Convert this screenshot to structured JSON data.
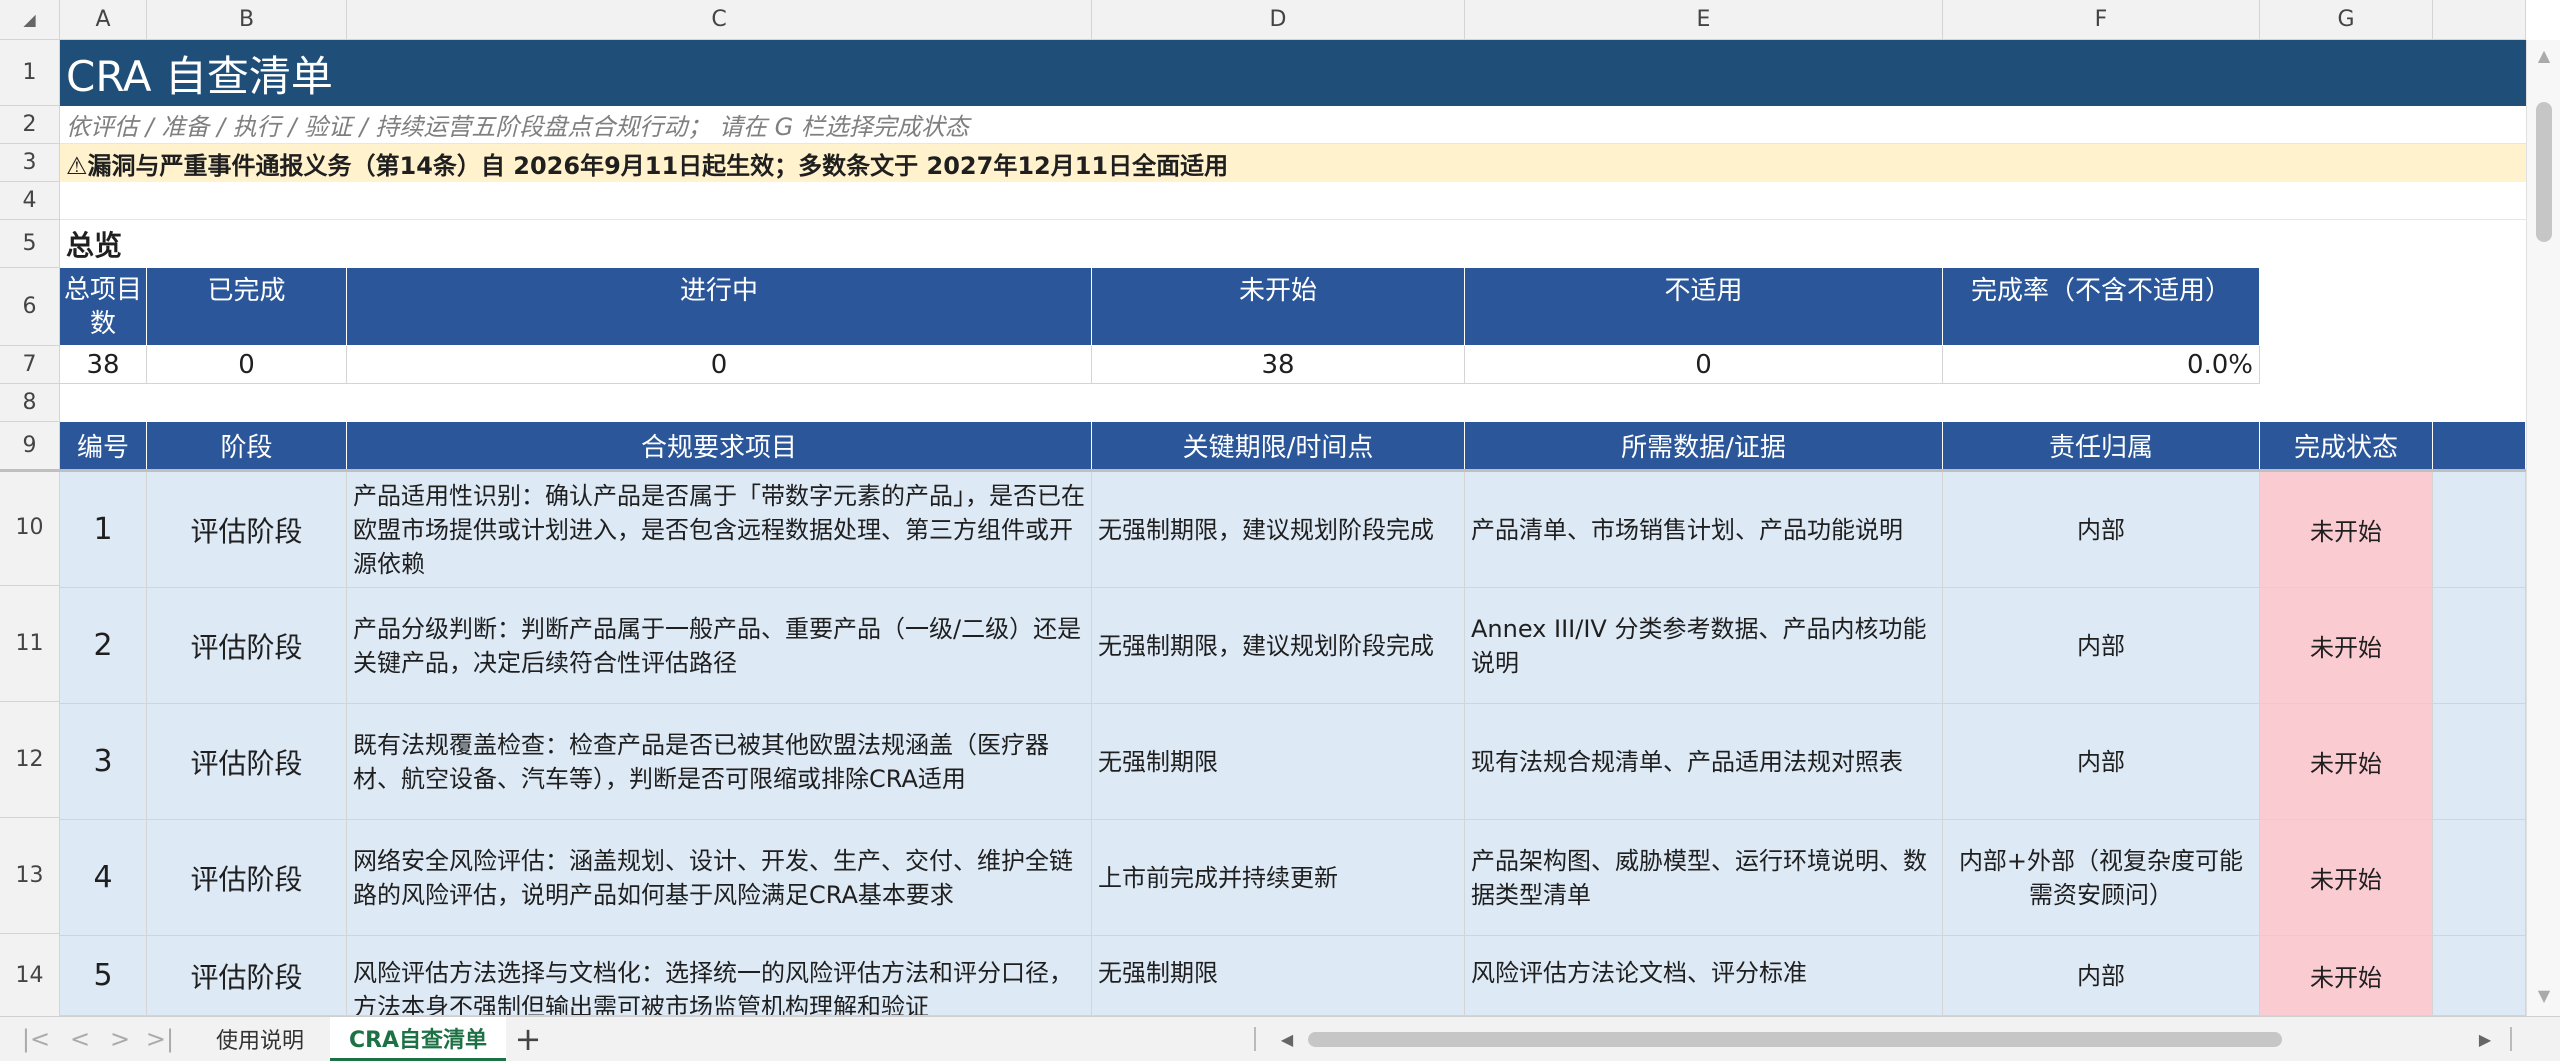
{
  "columns": [
    "A",
    "B",
    "C",
    "D",
    "E",
    "F",
    "G"
  ],
  "row_numbers": [
    "1",
    "2",
    "3",
    "4",
    "5",
    "6",
    "7",
    "8",
    "9",
    "10",
    "11",
    "12",
    "13",
    "14"
  ],
  "title": "CRA 自查清单",
  "subtitle": "依评估 / 准备 / 执行 / 验证 / 持续运营五阶段盘点合规行动； 请在 G 栏选择完成状态",
  "warning": "⚠漏洞与严重事件通报义务（第14条）自 2026年9月11日起生效；多数条文于 2027年12月11日全面适用",
  "overview_label": "总览",
  "summary": {
    "headers": [
      "总项目数",
      "已完成",
      "进行中",
      "未开始",
      "不适用",
      "完成率（不含不适用）"
    ],
    "values": [
      "38",
      "0",
      "0",
      "38",
      "0",
      "0.0%"
    ]
  },
  "table": {
    "headers": [
      "编号",
      "阶段",
      "合规要求项目",
      "关键期限/时间点",
      "所需数据/证据",
      "责任归属",
      "完成状态"
    ],
    "rows": [
      {
        "no": "1",
        "stage": "评估阶段",
        "item": "产品适用性识别：确认产品是否属于「带数字元素的产品」，是否已在欧盟市场提供或计划进入，是否包含远程数据处理、第三方组件或开源依赖",
        "deadline": "无强制期限，建议规划阶段完成",
        "evidence": "产品清单、市场销售计划、产品功能说明",
        "owner": "内部",
        "status": "未开始"
      },
      {
        "no": "2",
        "stage": "评估阶段",
        "item": "产品分级判断：判断产品属于一般产品、重要产品（一级/二级）还是关键产品，决定后续符合性评估路径",
        "deadline": "无强制期限，建议规划阶段完成",
        "evidence": "Annex III/IV 分类参考数据、产品内核功能说明",
        "owner": "内部",
        "status": "未开始"
      },
      {
        "no": "3",
        "stage": "评估阶段",
        "item": "既有法规覆盖检查：检查产品是否已被其他欧盟法规涵盖（医疗器材、航空设备、汽车等），判断是否可限缩或排除CRA适用",
        "deadline": "无强制期限",
        "evidence": "现有法规合规清单、产品适用法规对照表",
        "owner": "内部",
        "status": "未开始"
      },
      {
        "no": "4",
        "stage": "评估阶段",
        "item": "网络安全风险评估：涵盖规划、设计、开发、生产、交付、维护全链路的风险评估，说明产品如何基于风险满足CRA基本要求",
        "deadline": "上市前完成并持续更新",
        "evidence": "产品架构图、威胁模型、运行环境说明、数据类型清单",
        "owner": "内部+外部（视复杂度可能需资安顾问）",
        "status": "未开始"
      },
      {
        "no": "5",
        "stage": "评估阶段",
        "item": "风险评估方法选择与文档化：选择统一的风险评估方法和评分口径，方法本身不强制但输出需可被市场监管机构理解和验证",
        "deadline": "无强制期限",
        "evidence": "风险评估方法论文档、评分标准",
        "owner": "内部",
        "status": "未开始"
      }
    ]
  },
  "sheet_tabs": [
    "使用说明",
    "CRA自查清单"
  ],
  "active_tab": "CRA自查清单",
  "colors": {
    "header_blue": "#2b579a",
    "title_blue": "#1f4e79",
    "warning_bg": "#fff2cc",
    "row_bg": "#dde9f5",
    "status_pink": "#fbcbd2",
    "active_tab_green": "#1e7145"
  }
}
